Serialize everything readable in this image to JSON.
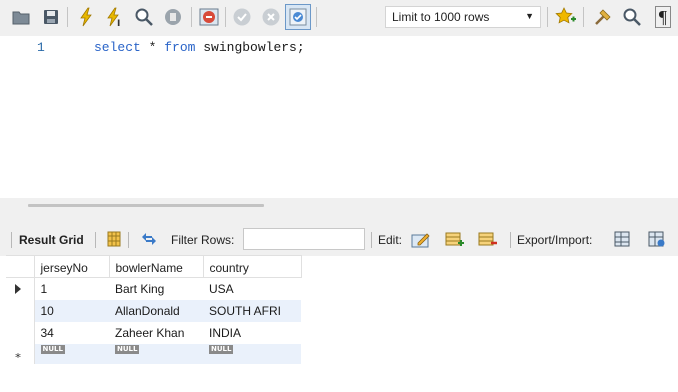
{
  "toolbar": {
    "limit_label": "Limit to 1000 rows",
    "icons": [
      "open-folder-icon",
      "save-icon",
      "execute-icon",
      "execute-current-icon",
      "explain-icon",
      "stop-icon",
      "toggle-error-icon",
      "commit-icon",
      "rollback-icon",
      "autocommit-icon",
      "bookmark-icon",
      "beautify-icon",
      "find-icon",
      "invisible-chars-icon"
    ]
  },
  "editor": {
    "line_number": "1",
    "kw_select": "select",
    "star": " * ",
    "kw_from": "from",
    "table": " swingbowlers;"
  },
  "result_toolbar": {
    "result_grid": "Result Grid",
    "filter_rows": "Filter Rows:",
    "filter_value": "",
    "edit": "Edit:",
    "export_import": "Export/Import:"
  },
  "grid": {
    "columns": [
      "jerseyNo",
      "bowlerName",
      "country"
    ],
    "rows": [
      [
        "1",
        "Bart King",
        "USA"
      ],
      [
        "10",
        "AllanDonald",
        "SOUTH AFRI"
      ],
      [
        "34",
        "Zaheer Khan",
        "INDIA"
      ]
    ],
    "null_label": "NULL"
  },
  "colors": {
    "keyword": "#2a64c8",
    "line_number": "#2a6aa8",
    "alt_row": "#eaf1fb",
    "toolbar_bg": "#f0f0f0"
  }
}
